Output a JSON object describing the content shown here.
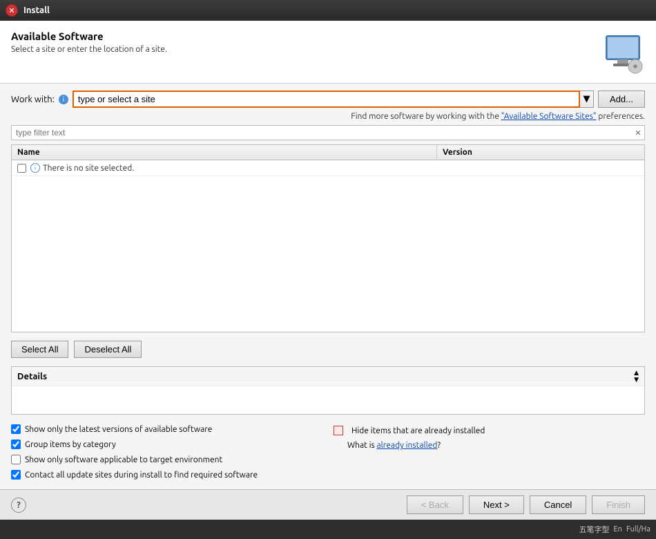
{
  "titleBar": {
    "closeLabel": "✕",
    "title": "Install"
  },
  "header": {
    "heading": "Available Software",
    "subtext": "Select a site or enter the location of a site."
  },
  "workWith": {
    "label": "Work with:",
    "inputPlaceholder": "type or select a site",
    "inputValue": "type or select a site",
    "addButtonLabel": "Add..."
  },
  "infoLine": {
    "text": "Find more software by working with the ",
    "linkText": "\"Available Software Sites\"",
    "suffix": " preferences."
  },
  "filter": {
    "placeholder": "type filter text",
    "clearIcon": "✕"
  },
  "table": {
    "columns": [
      "Name",
      "Version"
    ],
    "rows": [
      {
        "checked": false,
        "hasInfo": true,
        "label": "There is no site selected.",
        "version": ""
      }
    ]
  },
  "buttons": {
    "selectAll": "Select All",
    "deselectAll": "Deselect All"
  },
  "details": {
    "label": "Details",
    "content": ""
  },
  "options": [
    {
      "id": "opt1",
      "checked": true,
      "label": "Show only the latest versions of available software"
    },
    {
      "id": "opt2",
      "checked": true,
      "label": "Group items by category"
    },
    {
      "id": "opt3",
      "checked": false,
      "label": "Show only software applicable to target environment"
    },
    {
      "id": "opt4",
      "checked": true,
      "label": "Contact all update sites during install to find required software"
    }
  ],
  "hideInstalled": {
    "checked": false,
    "label": "Hide items that are already installed",
    "alreadyInstalledPrefix": "What is ",
    "alreadyInstalledLink": "already installed",
    "alreadyInstalledSuffix": "?"
  },
  "bottomBar": {
    "helpIcon": "?",
    "backButton": "< Back",
    "nextButton": "Next >",
    "cancelButton": "Cancel",
    "finishButton": "Finish"
  },
  "taskbar": {
    "items": [
      "五笔字型",
      "En",
      "Full/Ha"
    ]
  }
}
